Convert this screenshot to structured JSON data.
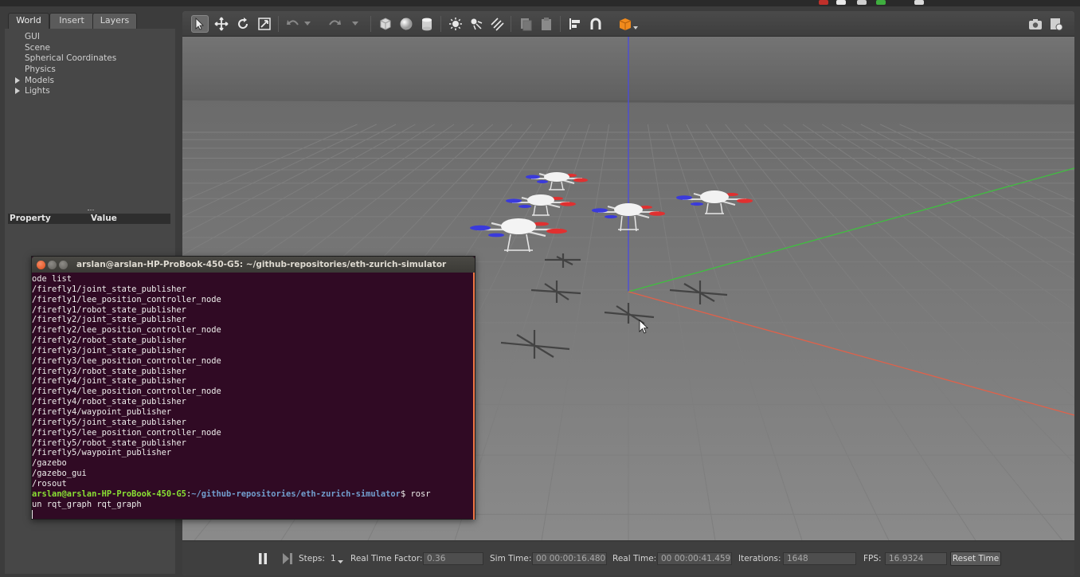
{
  "left_panel": {
    "tabs": [
      {
        "label": "World"
      },
      {
        "label": "Insert"
      },
      {
        "label": "Layers"
      }
    ],
    "tree": [
      {
        "label": "GUI"
      },
      {
        "label": "Scene"
      },
      {
        "label": "Spherical Coordinates"
      },
      {
        "label": "Physics"
      },
      {
        "label": "Models"
      },
      {
        "label": "Lights"
      }
    ],
    "property_header": {
      "property": "Property",
      "value": "Value"
    }
  },
  "toolbar": {
    "tools": [
      "select-arrow-icon",
      "translate-icon",
      "rotate-icon",
      "scale-icon",
      "undo-icon",
      "undo-dropdown-icon",
      "redo-icon",
      "redo-dropdown-icon",
      "box-shape-icon",
      "sphere-shape-icon",
      "cylinder-shape-icon",
      "point-light-icon",
      "spot-light-icon",
      "directional-light-icon",
      "copy-icon",
      "paste-icon",
      "align-icon",
      "snap-icon",
      "view-angle-icon",
      "screenshot-icon",
      "record-icon"
    ],
    "accent_color": "#f08a1c"
  },
  "bottom_bar": {
    "steps_label": "Steps:",
    "steps_value": "1",
    "rtf_label": "Real Time Factor:",
    "rtf_value": "0.36",
    "sim_time_label": "Sim Time:",
    "sim_time_value": "00 00:00:16.480",
    "real_time_label": "Real Time:",
    "real_time_value": "00 00:00:41.459",
    "iterations_label": "Iterations:",
    "iterations_value": "1648",
    "fps_label": "FPS:",
    "fps_value": "16.9324",
    "reset_label": "Reset Time"
  },
  "terminal": {
    "title": "arslan@arslan-HP-ProBook-450-G5: ~/github-repositories/eth-zurich-simulator",
    "lines": [
      "ode list",
      "/firefly1/joint_state_publisher",
      "/firefly1/lee_position_controller_node",
      "/firefly1/robot_state_publisher",
      "/firefly2/joint_state_publisher",
      "/firefly2/lee_position_controller_node",
      "/firefly2/robot_state_publisher",
      "/firefly3/joint_state_publisher",
      "/firefly3/lee_position_controller_node",
      "/firefly3/robot_state_publisher",
      "/firefly4/joint_state_publisher",
      "/firefly4/lee_position_controller_node",
      "/firefly4/robot_state_publisher",
      "/firefly4/waypoint_publisher",
      "/firefly5/joint_state_publisher",
      "/firefly5/lee_position_controller_node",
      "/firefly5/robot_state_publisher",
      "/firefly5/waypoint_publisher",
      "/gazebo",
      "/gazebo_gui",
      "/rosout"
    ],
    "prompt_user": "arslan@arslan-HP-ProBook-450-G5",
    "prompt_sep": ":",
    "prompt_path": "~/github-repositories/eth-zurich-simulator",
    "prompt_cmd": "$ rosr",
    "cmd_continuation": "un rqt_graph rqt_graph"
  },
  "scene": {
    "axis_colors": {
      "x": "#e0614a",
      "y": "#3fbf3f",
      "z": "#4a4ae0"
    },
    "drone_count": 5
  }
}
